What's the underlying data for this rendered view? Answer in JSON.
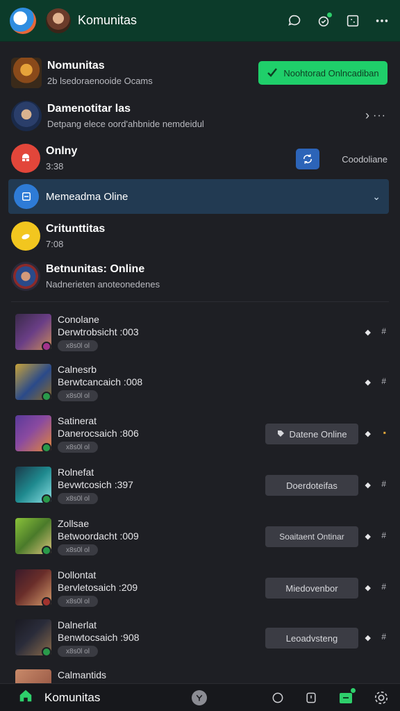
{
  "header": {
    "title": "Komunitas",
    "accent": "#0c3b2a"
  },
  "rows": {
    "r1": {
      "name": "Nomunitas",
      "sub": "2b lsedoraenooide Ocams",
      "button": "Noohtorad Onlncadiban"
    },
    "r2": {
      "name": "Damenotitar las",
      "sub": "Detpang elece oord'ahbnide nemdeidul"
    },
    "r3": {
      "name": "Onlny",
      "sub": "3:38",
      "right_label": "Coodoliane"
    },
    "banner": {
      "label": "Memeadma Oline"
    },
    "r4": {
      "name": "Critunttitas",
      "sub": "7:08"
    },
    "r5": {
      "name": "Betnunitas: Online",
      "sub": "Nadnerieten anoteonedenes"
    }
  },
  "games": [
    {
      "name": "Conolane",
      "sub": "Derwtrobsicht :003",
      "pill": "x8s0l ol",
      "button": "",
      "thumb": "#6a3e86",
      "badge": "#a2338c"
    },
    {
      "name": "Calnesrb",
      "sub": "Berwtcancaich :008",
      "pill": "x8s0l ol",
      "button": "",
      "thumb": "#c7a23a",
      "badge": "#2a9a4a"
    },
    {
      "name": "Satinerat",
      "sub": "Danerocsaich :806",
      "pill": "x8s0l ol",
      "button": "Datene Online",
      "thumb": "#8a4aa0",
      "badge": "#2a9a4a"
    },
    {
      "name": "Rolnefat",
      "sub": "Bevwtcosich :397",
      "pill": "x8s0l ol",
      "button": "Doerdoteifas",
      "thumb": "#1f8a8f",
      "badge": "#2a9a4a"
    },
    {
      "name": "Zollsae",
      "sub": "Betwoordacht :009",
      "pill": "x8s0l ol",
      "button": "Soaitaent Ontinar",
      "thumb": "#6aa02a",
      "badge": "#2a9a4a"
    },
    {
      "name": "Dollontat",
      "sub": "Bervletosaich :209",
      "pill": "x8s0l ol",
      "button": "Miedovenbor",
      "thumb": "#6a2e2a",
      "badge": "#a2332e"
    },
    {
      "name": "Dalnerlat",
      "sub": "Benwtocsaich :908",
      "pill": "x8s0l ol",
      "button": "Leoadvsteng",
      "thumb": "#2a2c3a",
      "badge": "#2a9a4a"
    },
    {
      "name": "Calmantids",
      "sub": "",
      "pill": "",
      "button": "",
      "thumb": "#c98a6a",
      "badge": "#2a9a4a"
    }
  ],
  "bottom": {
    "label": "Komunitas"
  }
}
